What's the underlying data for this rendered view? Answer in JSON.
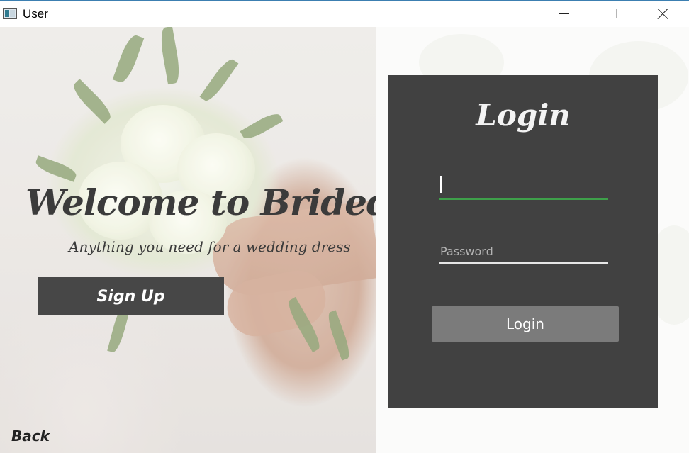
{
  "window": {
    "title": "User"
  },
  "welcome": {
    "title": "Welcome to Brided",
    "subtitle": "Anything you need for a wedding dress",
    "signup_label": "Sign Up",
    "back_label": "Back"
  },
  "login": {
    "heading": "Login",
    "username_value": "",
    "password_placeholder": "Password",
    "button_label": "Login"
  },
  "colors": {
    "card_background": "#414141",
    "username_underline": "#3ea04a",
    "login_button": "#7b7b7b",
    "signup_button": "#474747"
  }
}
